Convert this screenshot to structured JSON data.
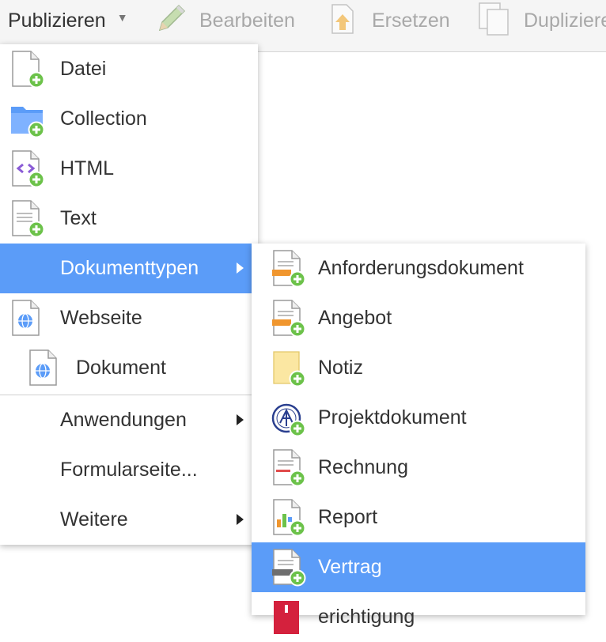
{
  "toolbar": {
    "publish_label": "Publizieren",
    "publish_caret": "▼",
    "edit_label": "Bearbeiten",
    "replace_label": "Ersetzen",
    "duplicate_label": "Duplizieren"
  },
  "main_menu": {
    "items": [
      {
        "label": "Datei",
        "icon": "file-add-icon"
      },
      {
        "label": "Collection",
        "icon": "folder-add-icon"
      },
      {
        "label": "HTML",
        "icon": "html-file-add-icon"
      },
      {
        "label": "Text",
        "icon": "text-file-add-icon"
      },
      {
        "label": "Dokumenttypen",
        "submenu": true,
        "active": true
      },
      {
        "label": "Webseite",
        "icon": "webpage-icon"
      },
      {
        "label": "Dokument",
        "icon": "webpage-document-icon"
      },
      {
        "label": "Anwendungen",
        "submenu": true
      },
      {
        "label": "Formularseite...",
        "submenu": false
      },
      {
        "label": "Weitere",
        "submenu": true
      }
    ]
  },
  "sub_menu": {
    "items": [
      {
        "label": "Anforderungsdokument",
        "icon": "requirement-doc-icon"
      },
      {
        "label": "Angebot",
        "icon": "offer-doc-icon"
      },
      {
        "label": "Notiz",
        "icon": "note-icon"
      },
      {
        "label": "Projektdokument",
        "icon": "project-doc-icon"
      },
      {
        "label": "Rechnung",
        "icon": "invoice-doc-icon"
      },
      {
        "label": "Report",
        "icon": "report-doc-icon"
      },
      {
        "label": "Vertrag",
        "icon": "contract-doc-icon",
        "active": true
      },
      {
        "label": "erichtigung",
        "icon": "correction-doc-icon"
      }
    ]
  },
  "colors": {
    "accent": "#5b9cf8",
    "add_badge": "#6cc24a",
    "toolbar_bg": "#f5f5f5"
  }
}
